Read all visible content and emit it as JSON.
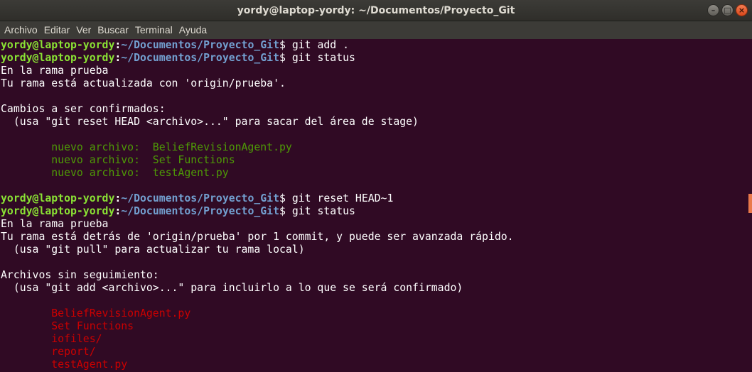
{
  "window": {
    "title": "yordy@laptop-yordy: ~/Documentos/Proyecto_Git",
    "controls": {
      "minimize": "–",
      "maximize": "□",
      "close": "×"
    }
  },
  "menubar": [
    "Archivo",
    "Editar",
    "Ver",
    "Buscar",
    "Terminal",
    "Ayuda"
  ],
  "prompt": {
    "user": "yordy@laptop-yordy",
    "sep": ":",
    "path": "~/Documentos/Proyecto_Git",
    "symbol": "$"
  },
  "lines": [
    {
      "type": "prompt",
      "cmd": " git add ."
    },
    {
      "type": "prompt",
      "cmd": " git status"
    },
    {
      "type": "text",
      "text": "En la rama prueba"
    },
    {
      "type": "text",
      "text": "Tu rama está actualizada con 'origin/prueba'."
    },
    {
      "type": "text",
      "text": ""
    },
    {
      "type": "text",
      "text": "Cambios a ser confirmados:"
    },
    {
      "type": "text",
      "text": "  (usa \"git reset HEAD <archivo>...\" para sacar del área de stage)"
    },
    {
      "type": "text",
      "text": ""
    },
    {
      "type": "green",
      "text": "        nuevo archivo:  BeliefRevisionAgent.py"
    },
    {
      "type": "green",
      "text": "        nuevo archivo:  Set Functions"
    },
    {
      "type": "green",
      "text": "        nuevo archivo:  testAgent.py"
    },
    {
      "type": "text",
      "text": ""
    },
    {
      "type": "prompt",
      "cmd": " git reset HEAD~1"
    },
    {
      "type": "prompt",
      "cmd": " git status"
    },
    {
      "type": "text",
      "text": "En la rama prueba"
    },
    {
      "type": "text",
      "text": "Tu rama está detrás de 'origin/prueba' por 1 commit, y puede ser avanzada rápido."
    },
    {
      "type": "text",
      "text": "  (usa \"git pull\" para actualizar tu rama local)"
    },
    {
      "type": "text",
      "text": ""
    },
    {
      "type": "text",
      "text": "Archivos sin seguimiento:"
    },
    {
      "type": "text",
      "text": "  (usa \"git add <archivo>...\" para incluirlo a lo que se será confirmado)"
    },
    {
      "type": "text",
      "text": ""
    },
    {
      "type": "red",
      "text": "        BeliefRevisionAgent.py"
    },
    {
      "type": "red",
      "text": "        Set Functions"
    },
    {
      "type": "red",
      "text": "        iofiles/"
    },
    {
      "type": "red",
      "text": "        report/"
    },
    {
      "type": "red",
      "text": "        testAgent.py"
    }
  ]
}
